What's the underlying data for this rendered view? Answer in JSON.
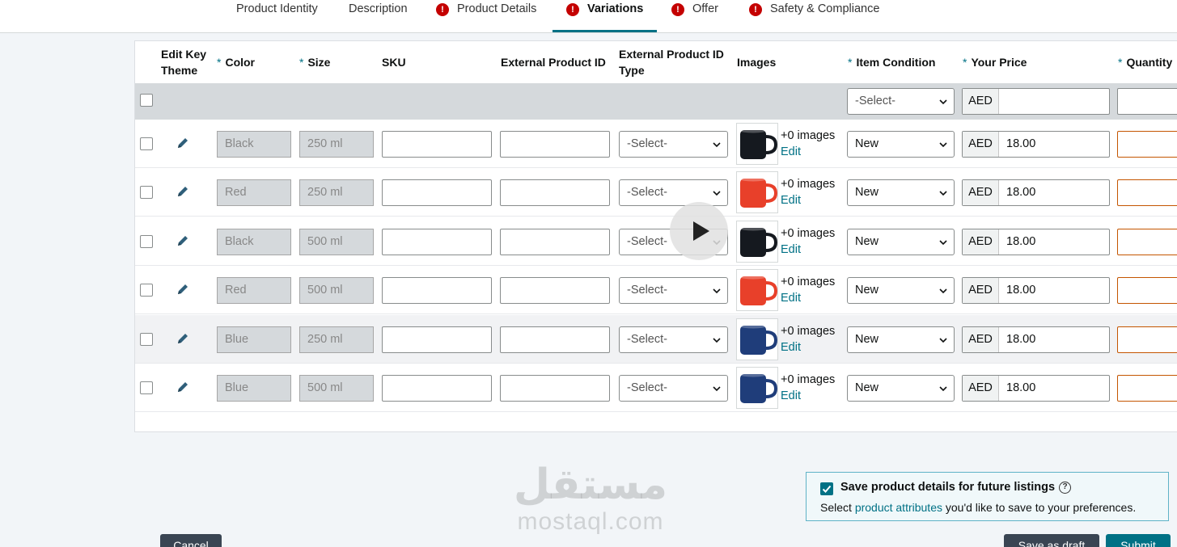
{
  "tabs": [
    {
      "label": "Product Identity",
      "error": false,
      "active": false
    },
    {
      "label": "Description",
      "error": false,
      "active": false
    },
    {
      "label": "Product Details",
      "error": true,
      "active": false
    },
    {
      "label": "Variations",
      "error": true,
      "active": true
    },
    {
      "label": "Offer",
      "error": true,
      "active": false
    },
    {
      "label": "Safety & Compliance",
      "error": true,
      "active": false
    }
  ],
  "table": {
    "headers": {
      "edit_theme": "Edit Key Theme",
      "color": "Color",
      "size": "Size",
      "sku": "SKU",
      "ext_id": "External Product ID",
      "ext_id_type": "External Product ID Type",
      "images": "Images",
      "condition": "Item Condition",
      "price": "Your Price",
      "quantity": "Quantity"
    },
    "bulk": {
      "condition": "-Select-",
      "currency": "AED",
      "price": ""
    },
    "rows": [
      {
        "color": "Black",
        "size": "250 ml",
        "ext_type": "-Select-",
        "mug_color": "#15191f",
        "images_text": "+0 images",
        "edit_label": "Edit",
        "condition": "New",
        "currency": "AED",
        "price": "18.00"
      },
      {
        "color": "Red",
        "size": "250 ml",
        "ext_type": "-Select-",
        "mug_color": "#e8402a",
        "images_text": "+0 images",
        "edit_label": "Edit",
        "condition": "New",
        "currency": "AED",
        "price": "18.00"
      },
      {
        "color": "Black",
        "size": "500 ml",
        "ext_type": "-Select-",
        "mug_color": "#15191f",
        "images_text": "+0 images",
        "edit_label": "Edit",
        "condition": "New",
        "currency": "AED",
        "price": "18.00"
      },
      {
        "color": "Red",
        "size": "500 ml",
        "ext_type": "-Select-",
        "mug_color": "#e8402a",
        "images_text": "+0 images",
        "edit_label": "Edit",
        "condition": "New",
        "currency": "AED",
        "price": "18.00"
      },
      {
        "color": "Blue",
        "size": "250 ml",
        "ext_type": "-Select-",
        "mug_color": "#1f3d7a",
        "images_text": "+0 images",
        "edit_label": "Edit",
        "condition": "New",
        "currency": "AED",
        "price": "18.00"
      },
      {
        "color": "Blue",
        "size": "500 ml",
        "ext_type": "-Select-",
        "mug_color": "#1f3d7a",
        "images_text": "+0 images",
        "edit_label": "Edit",
        "condition": "New",
        "currency": "AED",
        "price": "18.00"
      }
    ]
  },
  "save_box": {
    "title": "Save product details for future listings",
    "help": "?",
    "desc_prefix": "Select ",
    "desc_link": "product attributes",
    "desc_suffix": " you'd like to save to your preferences."
  },
  "watermark": {
    "arabic": "مستقل",
    "latin": "mostaql.com"
  },
  "buttons": {
    "cancel": "Cancel",
    "draft": "Save as draft",
    "submit": "Submit"
  },
  "colors": {
    "accent": "#007185",
    "error": "#c40000",
    "qty_error_border": "#c45500"
  }
}
